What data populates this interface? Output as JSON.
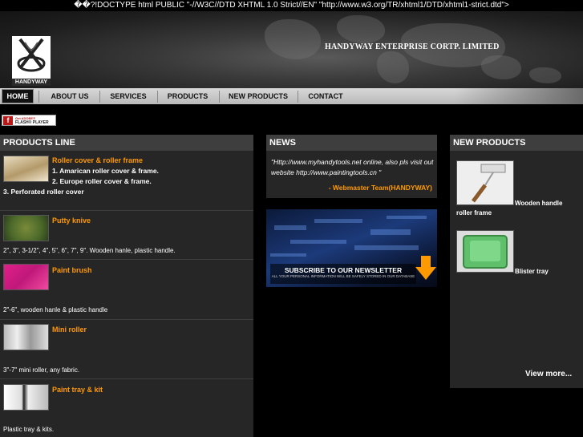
{
  "doctype_text": "��?!DOCTYPE html PUBLIC \"-//W3C//DTD XHTML 1.0 Strict//EN\" \"http://www.w3.org/TR/xhtml1/DTD/xhtml1-strict.dtd\">",
  "header": {
    "logo_text": "HANDYWAY",
    "company_name": "HANDYWAY ENTERPRISE CORTP. LIMITED"
  },
  "nav": {
    "items": [
      {
        "label": "HOME",
        "active": true
      },
      {
        "label": "ABOUT US"
      },
      {
        "label": "SERVICES"
      },
      {
        "label": "PRODUCTS"
      },
      {
        "label": "NEW PRODUCTS"
      },
      {
        "label": "CONTACT"
      }
    ]
  },
  "flash_badge": {
    "line1": "Get ADOBE®",
    "line2": "FLASH® PLAYER",
    "icon": "flash-player-icon"
  },
  "products_line": {
    "heading": "PRODUCTS LINE",
    "items": [
      {
        "title": "Roller cover & roller frame",
        "lines": [
          "1. Amarican roller cover & frame.",
          "2. Europe roller cover & frame.",
          "3. Perforated roller cover"
        ]
      },
      {
        "title": "Putty knive",
        "desc": "2\", 3\", 3-1/2\", 4\", 5\", 6\", 7\", 9\". Wooden hanle, plastic handle."
      },
      {
        "title": "Paint brush",
        "desc": "2\"-6\", wooden hanle & plastic handle"
      },
      {
        "title": "Mini roller",
        "desc": "3\"-7\" mini roller, any fabric."
      },
      {
        "title": "Paint tray & kit",
        "desc": "Plastic tray & kits."
      }
    ]
  },
  "news": {
    "heading": "NEWS",
    "quote": "\"Http://www.myhandytools.net online, also pls visit out website http://www.paintingtools.cn \"",
    "signature": "- Webmaster Team(HANDYWAY)"
  },
  "newsletter": {
    "title": "SUBSCRIBE TO OUR NEWSLETTER",
    "subtitle": "ALL YOUR PERSONAL INFORMATION WILL BE SAFELY STORED IN OUR DATABASE",
    "icon": "arrow-down-icon",
    "arrow_color": "#ff9900"
  },
  "new_products": {
    "heading": "NEW PRODUCTS",
    "items": [
      {
        "name_1": "Wooden handle",
        "name_2": "roller frame"
      },
      {
        "name_1": "Blister tray"
      }
    ],
    "view_more": "View more..."
  },
  "colors": {
    "accent": "#ff9900",
    "panel_bg": "#262626",
    "panel_head": "#3e3e3e"
  }
}
